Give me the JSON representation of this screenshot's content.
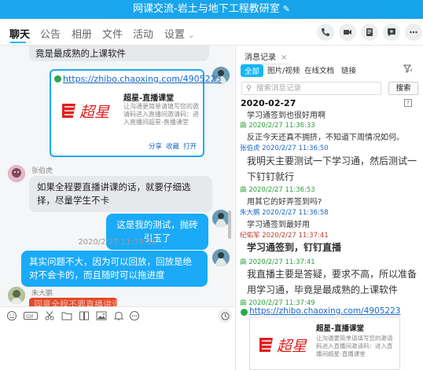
{
  "window": {
    "title": "网课交流-岩土与地下工程教研室",
    "edit_icon": "pencil-icon"
  },
  "tabs": [
    "聊天",
    "公告",
    "相册",
    "文件",
    "活动",
    "设置"
  ],
  "colors": {
    "accent": "#12b7f5",
    "bubble_blue": "#1aaaf7",
    "title_bar": "#1da6f0"
  },
  "chat": {
    "msg_top": "竟是最成熟的上课软件",
    "link_card": {
      "url": "https://zhibo.chaoxing.com/4905223",
      "title": "超星-直播课堂",
      "desc": "让沟通更简单请填写您的邀请码进入直播间邀请码：进入直播间超星-直播课堂",
      "logo_text": "超星",
      "actions": [
        "分享",
        "收藏",
        "打开"
      ]
    },
    "sender1": "张伯虎",
    "msg_zhang": "如果全程要直播讲课的话，就要仔细选择，尽量学生不卡",
    "msg_self1": "这是我的测试，抛砖引玉了",
    "timestamp": "2020/2/27 11:38:36",
    "msg_self2": "其实问题不大，因为可以回放，回放是绝对不会卡的，而且随时可以拖进度",
    "sender2": "朱大鹏",
    "msg_red": "同意全程不要直播讲课"
  },
  "panel": {
    "tab": "消息记录",
    "filters": [
      "全部",
      "图片/视频",
      "在线文档",
      "链接"
    ],
    "search_placeholder": "搜索消息记录",
    "search_button": "搜索",
    "date": "2020-02-27",
    "records": [
      {
        "meta": "",
        "text": "学习通签到也很好用啊"
      },
      {
        "meta": "曲 2020/2/27 11:36:33",
        "text": "反正今天还真不拥挤，不知道下周情况如何。"
      },
      {
        "meta": "张伯虎 2020/2/27 11:36:50",
        "text": "我明天主要测试一下学习通，然后测试一下钉钉就行"
      },
      {
        "meta": "曲 2020/2/27 11:36:53",
        "text": "用其它的好弄签到吗?"
      },
      {
        "meta": "朱大鹏 2020/2/27 11:36:58",
        "text": "学习通签到最好用"
      },
      {
        "meta": "纪佑军 2020/2/27 11:37:41",
        "text": "学习通签到，钉钉直播"
      },
      {
        "meta": "曲 2020/2/27 11:37:41",
        "text": "我直播主要是答疑，要求不高，所以准备用学习通，毕竟是最成熟的上课软件"
      },
      {
        "meta": "曲 2020/2/27 11:37:49",
        "text": ""
      }
    ],
    "link_card": {
      "url": "https://zhibo.chaoxing.com/4905223",
      "title": "超星-直播课堂",
      "desc": "让沟通更简单请填写您的邀请码进入直播间邀请码：进入直播间超星-直播课堂"
    }
  }
}
